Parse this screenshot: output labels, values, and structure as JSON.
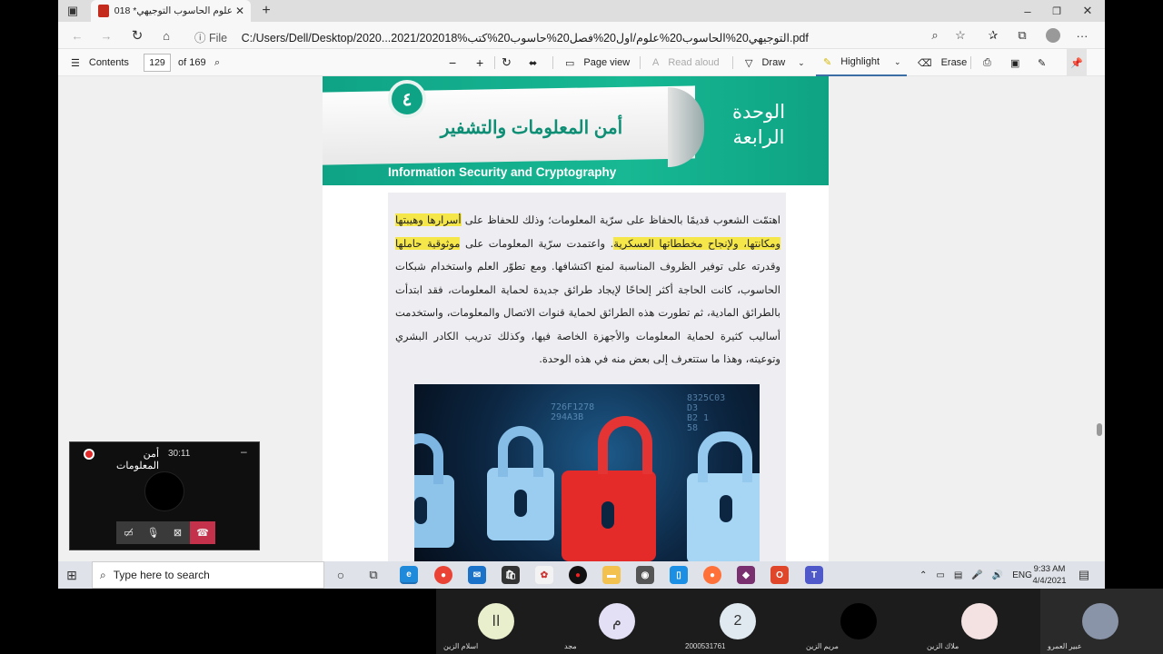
{
  "browser": {
    "tab_title": "علوم الحاسوب التوجيهي* 2018.pdf",
    "file_label": "File",
    "url": "C:/Users/Dell/Desktop/2020...2021/202018%التوجيهي20%الحاسوب20%علوم/اول20%فصل20%حاسوب20%كتب.pdf",
    "icons": [
      "back-icon",
      "forward-icon",
      "refresh-icon",
      "home-icon",
      "info-icon",
      "zoom-icon",
      "favorite-add-icon",
      "favorites-icon",
      "collections-icon",
      "profile-icon",
      "more-icon"
    ]
  },
  "pdf_toolbar": {
    "contents": "Contents",
    "page_current": "129",
    "page_total": "of 169",
    "page_view": "Page view",
    "read_aloud": "Read aloud",
    "draw": "Draw",
    "highlight": "Highlight",
    "erase": "Erase"
  },
  "document": {
    "unit_label_line1": "الوحدة",
    "unit_label_line2": "الرابعة",
    "unit_number": "٤",
    "chapter_title": "أمن المعلومات والتشفير",
    "english_title": "Information Security and Cryptography",
    "p_start": "اهتمّت الشعوب قديمًا بالحفاظ على سرّية المعلومات؛ وذلك للحفاظ على ",
    "p_hl1": "أسرارها وهيبتها ومكانتها، ولإنجاح مخططاتها العسكرية",
    "p_mid": ". واعتمدت سرّية المعلومات على ",
    "p_hl2": "موثوقية حاملها",
    "p_end": " وقدرته على توفير الظروف المناسبة لمنع اكتشافها. ومع تطوّر العلم واستخدام شبكات الحاسوب، كانت الحاجة أكثر إلحاحًا لإيجاد طرائق جديدة لحماية المعلومات، فقد ابتدأت بالطرائق المادية، ثم تطورت هذه الطرائق لحماية قنوات الاتصال والمعلومات، واستخدمت أساليب كثيرة لحماية المعلومات والأجهزة الخاصة فيها، وكذلك تدريب الكادر البشري وتوعيته، وهذا ما ستتعرف إلى بعض منه في هذه الوحدة.",
    "image_subject": "padlocks-image"
  },
  "meeting": {
    "title": "أمن المعلومات",
    "timer": "30:11",
    "minimize": "–"
  },
  "taskbar": {
    "search_placeholder": "Type here to search",
    "language": "ENG",
    "time": "9:33 AM",
    "date": "4/4/2021"
  },
  "participants": [
    {
      "name": "اسلام الزين",
      "initial": "اا",
      "color": "#e9eecd"
    },
    {
      "name": "مجد",
      "initial": "م",
      "color": "#e3e0f5"
    },
    {
      "name": "2000531761",
      "initial": "2",
      "color": "#dfe9ef"
    },
    {
      "name": "مريم الزين",
      "initial": "",
      "color": "#000000"
    },
    {
      "name": "ملاك الزين",
      "initial": "",
      "color": "#f4e2e2"
    },
    {
      "name": "عبير العمرو",
      "initial": "",
      "color": "#8a94a8"
    }
  ]
}
